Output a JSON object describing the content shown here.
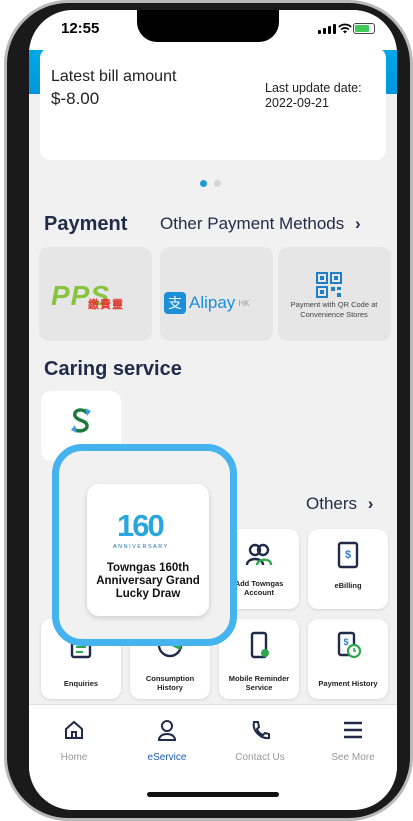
{
  "status": {
    "time": "12:55"
  },
  "bill": {
    "label": "Latest bill amount",
    "amount": "$-8.00",
    "update_label": "Last update date:",
    "update_date": "2022-09-21"
  },
  "carousel": {
    "active_index": 0,
    "count": 2
  },
  "payment": {
    "title": "Payment",
    "other_methods": "Other Payment Methods",
    "methods": [
      {
        "name": "pps-icon",
        "label": "PPS",
        "sub": "繳費靈"
      },
      {
        "name": "alipay-icon",
        "label": "Alipay",
        "sub": "HK"
      },
      {
        "name": "qr-code-icon",
        "label": "Payment with QR Code at Convenience Stores"
      }
    ]
  },
  "caring": {
    "title": "Caring service"
  },
  "others": {
    "label": "Others"
  },
  "lucky_draw": {
    "logo_num": "160",
    "logo_sub": "ANNIVERSARY",
    "label": "Towngas 160th Anniversary Grand Lucky Draw"
  },
  "services": [
    {
      "label": "Add Towngas Account"
    },
    {
      "label": "eBilling"
    },
    {
      "label": "Enquiries"
    },
    {
      "label": "Consumption History"
    },
    {
      "label": "Mobile Reminder Service"
    },
    {
      "label": "Payment History"
    }
  ],
  "nav": [
    {
      "label": "Home"
    },
    {
      "label": "eService"
    },
    {
      "label": "Contact Us"
    },
    {
      "label": "See More"
    }
  ],
  "colors": {
    "accent": "#00a8e8",
    "navy": "#1f2b48",
    "active_nav": "#1e5bb5",
    "highlight": "#45b3ee"
  }
}
